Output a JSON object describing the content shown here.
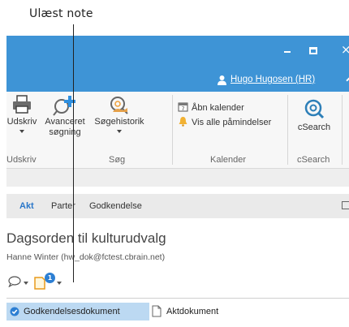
{
  "callout": {
    "label": "Ulæst note"
  },
  "titlebar": {
    "user_link": "Hugo Hugosen (HR)",
    "minimize_icon": "minimize-icon",
    "maximize_icon": "maximize-icon",
    "close_icon": "close-icon",
    "close_glyph": "×",
    "accent_color": "#3e94d6"
  },
  "ribbon": {
    "print": {
      "label": "Udskriv",
      "icon": "printer-icon"
    },
    "advanced_search": {
      "label_line1": "Avanceret",
      "label_line2": "søgning",
      "icon": "search-plus-icon"
    },
    "search_history": {
      "label": "Søgehistorik",
      "icon": "search-history-icon"
    },
    "open_calendar": {
      "label": "Åbn kalender",
      "icon": "calendar-icon"
    },
    "show_reminders": {
      "label": "Vis alle påmindelser",
      "icon": "bell-icon"
    },
    "csearch": {
      "label": "cSearch",
      "icon": "csearch-icon"
    },
    "groups": {
      "print": "Udskriv",
      "search": "Søg",
      "calendar": "Kalender",
      "csearch": "cSearch"
    }
  },
  "tabs": [
    {
      "label": "Akt",
      "active": true
    },
    {
      "label": "Parter",
      "active": false
    },
    {
      "label": "Godkendelse",
      "active": false
    }
  ],
  "document": {
    "title": "Dagsorden til kulturudvalg",
    "subtitle": "Hanne Winter (hw_dok@fctest.cbrain.net)"
  },
  "actions": {
    "comment_icon": "comment-icon",
    "note_icon": "note-icon",
    "unread_count": "1"
  },
  "doc_tabs": [
    {
      "label": "Godkendelsesdokument",
      "icon": "check-circle-icon",
      "selected": true
    },
    {
      "label": "Aktdokument",
      "icon": "document-icon",
      "selected": false
    }
  ]
}
